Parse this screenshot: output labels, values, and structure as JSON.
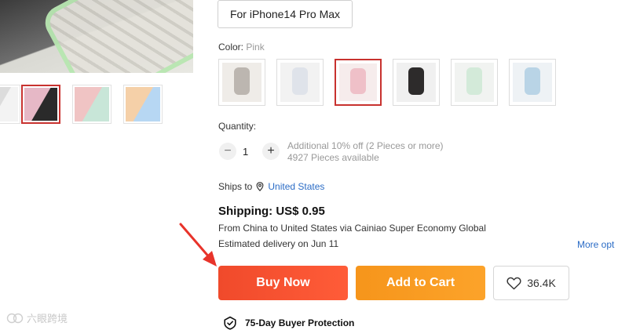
{
  "product": {
    "variant_label": "For iPhone14 Pro Max",
    "color_label": "Color:",
    "color_value": "Pink"
  },
  "gallery": {
    "thumbs": [
      {
        "name": "thumb-clear",
        "colors": [
          "#dcdcdc",
          "#f3f3f3"
        ]
      },
      {
        "name": "thumb-pink-black",
        "colors": [
          "#e6b8c6",
          "#2a2a2a"
        ]
      },
      {
        "name": "thumb-rainbow",
        "colors": [
          "#f0c4c4",
          "#c8e6d8"
        ]
      },
      {
        "name": "thumb-multi",
        "colors": [
          "#f5d0a8",
          "#b7d7f3"
        ]
      }
    ],
    "selected_index": 1
  },
  "swatches": {
    "items": [
      {
        "name": "swatch-clear-black",
        "bg": "#efece8",
        "phone": "#bcb6b0"
      },
      {
        "name": "swatch-clear",
        "bg": "#f2f2f2",
        "phone": "#dfe3ea"
      },
      {
        "name": "swatch-pink",
        "bg": "#f6ecec",
        "phone": "#efc0c8"
      },
      {
        "name": "swatch-black",
        "bg": "#f0f0f0",
        "phone": "#2d2b2b"
      },
      {
        "name": "swatch-green",
        "bg": "#f1f3f1",
        "phone": "#d3ead9"
      },
      {
        "name": "swatch-blue",
        "bg": "#eef2f5",
        "phone": "#b9d4e6"
      }
    ],
    "selected_index": 2
  },
  "quantity": {
    "label": "Quantity:",
    "minus": "−",
    "value": "1",
    "plus": "+",
    "discount_note": "Additional 10% off (2 Pieces or more)",
    "available": "4927 Pieces available"
  },
  "shipping": {
    "ships_to_label": "Ships to",
    "ships_to_country": "United States",
    "title": "Shipping: US$ 0.95",
    "route_from": "From",
    "route_origin": "China",
    "route_to": "to",
    "route_destination": "United States",
    "route_via": "via Cainiao Super Economy Global",
    "delivery_text": "Estimated delivery on",
    "delivery_date": "Jun 11",
    "more_options": "More opt"
  },
  "actions": {
    "buy_now": "Buy Now",
    "add_to_cart": "Add to Cart",
    "wishlist_count": "36.4K"
  },
  "protection": {
    "title": "75-Day Buyer Protection"
  },
  "watermark": {
    "text": "六眼跨境"
  },
  "colors": {
    "selected_border": "#c8322f",
    "link": "#2b6cc6",
    "buy_now": "#f04a2b",
    "add_to_cart": "#f6951b",
    "arrow": "#e8332a"
  }
}
